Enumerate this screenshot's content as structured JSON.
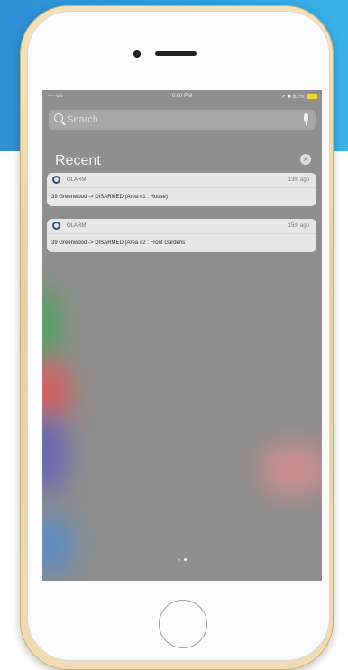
{
  "status_bar": {
    "carrier": "•••oo",
    "time": "6:00 PM",
    "indicators": "↗ ✱ 61%"
  },
  "search": {
    "placeholder": "Search"
  },
  "recent": {
    "title": "Recent"
  },
  "notifications": [
    {
      "app": "OLARM",
      "time": "13m ago",
      "body": "39 Greenwood -> DISARMED (Area #1 : House)"
    },
    {
      "app": "OLARM",
      "time": "15m ago",
      "body": "39 Greenwood -> DISARMED (Area #2 : Front Gardens"
    }
  ],
  "colors": {
    "banner": "#2a9ee0",
    "phone_frame": "#ecd6a8",
    "battery": "#f3d431",
    "app_icon": "#2c4f86"
  },
  "icons": [
    "search-icon",
    "microphone-icon",
    "clear-icon",
    "olarm-app-icon"
  ]
}
